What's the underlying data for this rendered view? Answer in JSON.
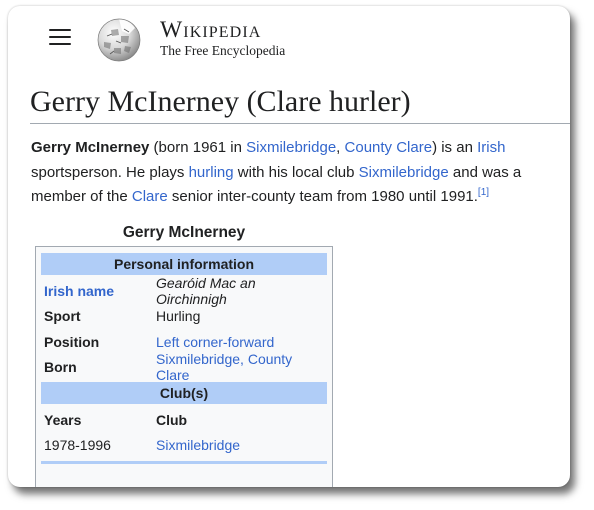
{
  "header": {
    "menu_icon": "hamburger-menu-icon",
    "logo_icon": "wikipedia-globe-icon",
    "wordmark": "Wikipedia",
    "tagline": "The Free Encyclopedia"
  },
  "article": {
    "title": "Gerry McInerney (Clare hurler)",
    "lead": {
      "subject": "Gerry McInerney",
      "t1": " (born 1961 in ",
      "link_sixmilebridge": "Sixmilebridge",
      "t2": ", ",
      "link_county_clare": "County Clare",
      "t3": ") is an ",
      "link_irish": "Irish",
      "t4": " sportsperson. He plays ",
      "link_hurling": "hurling",
      "t5": " with his local club ",
      "link_sixmilebridge2": "Sixmilebridge",
      "t6": " and was a member of the ",
      "link_clare": "Clare",
      "t7": " senior inter-county team from 1980 until 1991.",
      "ref": "[1]"
    }
  },
  "infobox": {
    "caption": "Gerry McInerney",
    "section_personal": "Personal information",
    "irish_name_label": "Irish name",
    "irish_name_value": "Gearóid Mac an Oirchinnigh",
    "sport_label": "Sport",
    "sport_value": "Hurling",
    "position_label": "Position",
    "position_value": "Left corner-forward",
    "born_label": "Born",
    "born_place": "Sixmilebridge",
    "born_sep": ", ",
    "born_county": "County Clare",
    "section_clubs": "Club(s)",
    "years_header": "Years",
    "club_header": "Club",
    "club_years": "1978-1996",
    "club_name": "Sixmilebridge"
  },
  "colors": {
    "link": "#3366cc",
    "text": "#202122",
    "infobox_header": "#b0cdf7",
    "infobox_bg": "#f8f9fa"
  }
}
